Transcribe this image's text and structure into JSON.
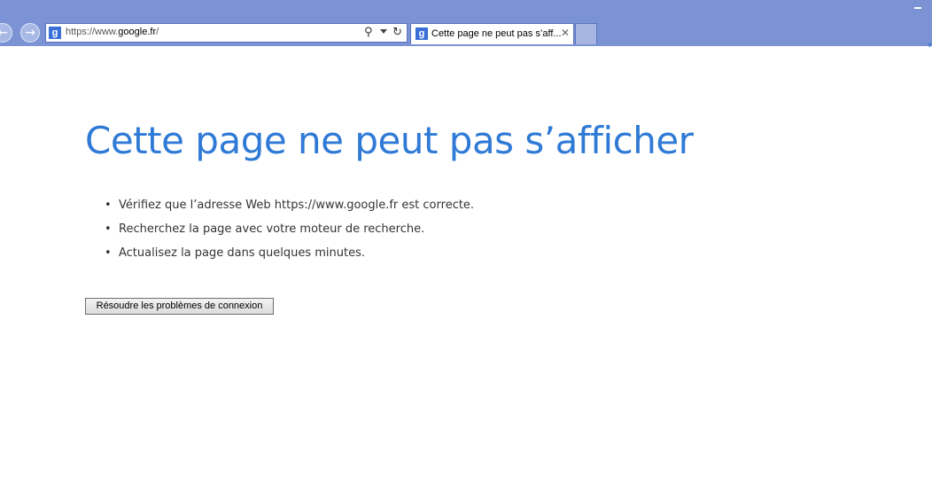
{
  "browser": {
    "address_bar": {
      "url_prefix": "https://www.",
      "url_host": "google.fr",
      "url_suffix": "/"
    },
    "tab": {
      "label": "Cette page ne peut pas s’aff..."
    },
    "icons": {
      "back": "back-arrow-icon",
      "forward": "forward-arrow-icon",
      "site": "google-favicon",
      "search": "search-icon",
      "refresh": "refresh-icon",
      "close": "close-icon"
    },
    "colors": {
      "chrome": "#7b92d4",
      "accent": "#2f7ad6"
    }
  },
  "error_page": {
    "title": "Cette page ne peut pas s’afficher",
    "suggestions": [
      "Vérifiez que l’adresse Web https://www.google.fr est correcte.",
      "Recherchez la page avec votre moteur de recherche.",
      "Actualisez la page dans quelques minutes."
    ],
    "fix_button_label": "Résoudre les problèmes de connexion"
  }
}
